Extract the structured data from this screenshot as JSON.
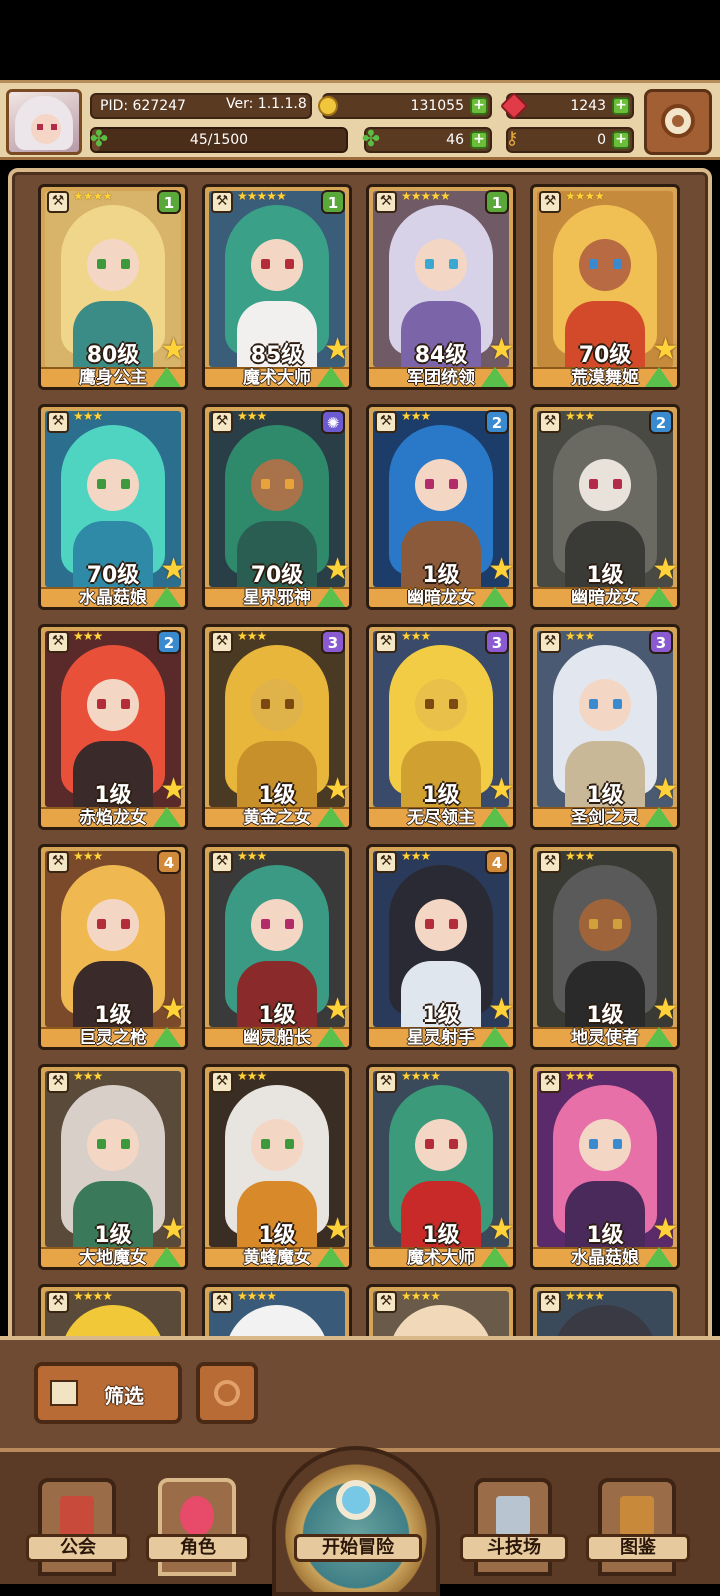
{
  "header": {
    "pid": "PID: 627247",
    "version": "Ver: 1.1.1.8",
    "gold": "131055",
    "gems": "1243",
    "clovers": "46",
    "keys": "0",
    "stamina": "45/1500",
    "stamina_fraction": 0.03
  },
  "cards": [
    {
      "name": "鹰身公主",
      "level": "80级",
      "badge": "1",
      "badge_color": "#5aa83a",
      "stars": "★★★★",
      "hair": "#f0d68a",
      "skin": "#f4d6c4",
      "eye": "#3c9a3c",
      "outfit": "#3b8c86",
      "bg": "#d7b46a"
    },
    {
      "name": "魔术大师",
      "level": "85级",
      "badge": "1",
      "badge_color": "#5aa83a",
      "stars": "★★★★★",
      "hair": "#3aa087",
      "skin": "#f4d6c4",
      "eye": "#b42b3a",
      "outfit": "#f2f0ee",
      "bg": "#3a5d7a"
    },
    {
      "name": "军团统领",
      "level": "84级",
      "badge": "1",
      "badge_color": "#5aa83a",
      "stars": "★★★★★",
      "hair": "#d7d2e8",
      "skin": "#f4d6c4",
      "eye": "#3aa8d0",
      "outfit": "#7b64a8",
      "bg": "#6f5a66"
    },
    {
      "name": "荒漠舞姬",
      "level": "70级",
      "badge": "",
      "badge_color": "",
      "stars": "★★★★",
      "hair": "#f0c054",
      "skin": "#b86a42",
      "eye": "#3a8ad0",
      "outfit": "#d24a2a",
      "bg": "#c68a3c"
    },
    {
      "name": "水晶菇娘",
      "level": "70级",
      "badge": "",
      "badge_color": "",
      "stars": "★★★",
      "hair": "#4fd4c2",
      "skin": "#f4d6c4",
      "eye": "#3c9a3c",
      "outfit": "#2f8aa8",
      "bg": "#2c6e8e"
    },
    {
      "name": "星界邪神",
      "level": "70级",
      "badge": "✺",
      "badge_color": "#6b5ad0",
      "stars": "★★★",
      "hair": "#2e8a6a",
      "skin": "#a8724a",
      "eye": "#e8a43a",
      "outfit": "#2a5e52",
      "bg": "#2a3e48"
    },
    {
      "name": "幽暗龙女",
      "level": "1级",
      "badge": "2",
      "badge_color": "#3a8ad0",
      "stars": "★★★",
      "hair": "#2a78c8",
      "skin": "#f4d6c4",
      "eye": "#b42b6a",
      "outfit": "#8a5a3a",
      "bg": "#1c3c6a"
    },
    {
      "name": "幽暗龙女",
      "level": "1级",
      "badge": "2",
      "badge_color": "#3a8ad0",
      "stars": "★★★",
      "hair": "#6a6a62",
      "skin": "#e8e2da",
      "eye": "#b42b4a",
      "outfit": "#3a3a36",
      "bg": "#4a4a44"
    },
    {
      "name": "赤焰龙女",
      "level": "1级",
      "badge": "2",
      "badge_color": "#3a8ad0",
      "stars": "★★★",
      "hair": "#e8503a",
      "skin": "#f4d6c4",
      "eye": "#b42b3a",
      "outfit": "#3a2a2a",
      "bg": "#5a2a2a"
    },
    {
      "name": "黄金之女",
      "level": "1级",
      "badge": "3",
      "badge_color": "#8a5ad0",
      "stars": "★★★",
      "hair": "#e8b63a",
      "skin": "#e0b24a",
      "eye": "#7a4a10",
      "outfit": "#c8902a",
      "bg": "#4a3a24"
    },
    {
      "name": "无尽领主",
      "level": "1级",
      "badge": "3",
      "badge_color": "#8a5ad0",
      "stars": "★★★",
      "hair": "#f2cc44",
      "skin": "#e8c04a",
      "eye": "#7a4a10",
      "outfit": "#d0a030",
      "bg": "#3a4a6a"
    },
    {
      "name": "圣剑之灵",
      "level": "1级",
      "badge": "3",
      "badge_color": "#8a5ad0",
      "stars": "★★★",
      "hair": "#e2e6ee",
      "skin": "#f4d6c4",
      "eye": "#3a8ad0",
      "outfit": "#c8b898",
      "bg": "#4a5a72"
    },
    {
      "name": "巨灵之枪",
      "level": "1级",
      "badge": "4",
      "badge_color": "#d08a3a",
      "stars": "★★★",
      "hair": "#f0b850",
      "skin": "#f4d6c4",
      "eye": "#b42b3a",
      "outfit": "#3a2a2a",
      "bg": "#7a4a2a"
    },
    {
      "name": "幽灵船长",
      "level": "1级",
      "badge": "",
      "badge_color": "",
      "stars": "★★★",
      "hair": "#3a9a84",
      "skin": "#f4d6c4",
      "eye": "#b42b6a",
      "outfit": "#8a2a2a",
      "bg": "#3a3a3a"
    },
    {
      "name": "星灵射手",
      "level": "1级",
      "badge": "4",
      "badge_color": "#d08a3a",
      "stars": "★★★",
      "hair": "#2a2a34",
      "skin": "#f4d6c4",
      "eye": "#b42b3a",
      "outfit": "#dfe6ee",
      "bg": "#2a3a5a"
    },
    {
      "name": "地灵使者",
      "level": "1级",
      "badge": "",
      "badge_color": "",
      "stars": "★★★",
      "hair": "#5a5a5a",
      "skin": "#a0643a",
      "eye": "#d0a03a",
      "outfit": "#2a2a2a",
      "bg": "#3a3a34"
    },
    {
      "name": "大地魔女",
      "level": "1级",
      "badge": "",
      "badge_color": "",
      "stars": "★★★",
      "hair": "#d8d0c8",
      "skin": "#f4d6c4",
      "eye": "#3c9a3c",
      "outfit": "#3a7a5a",
      "bg": "#5a4a3a"
    },
    {
      "name": "黄蜂魔女",
      "level": "1级",
      "badge": "",
      "badge_color": "",
      "stars": "★★★",
      "hair": "#e8e4e0",
      "skin": "#f4d6c4",
      "eye": "#3c9a3c",
      "outfit": "#d88a2a",
      "bg": "#3a2e24"
    },
    {
      "name": "魔术大师",
      "level": "1级",
      "badge": "",
      "badge_color": "",
      "stars": "★★★★",
      "hair": "#3a9a7a",
      "skin": "#f4d6c4",
      "eye": "#b42b3a",
      "outfit": "#c82a2a",
      "bg": "#3a4a5a"
    },
    {
      "name": "水晶菇娘",
      "level": "1级",
      "badge": "",
      "badge_color": "",
      "stars": "★★★",
      "hair": "#e870a8",
      "skin": "#f4d6c4",
      "eye": "#3a8ad0",
      "outfit": "#4a2a5a",
      "bg": "#5a2a6a"
    },
    {
      "name": "",
      "level": "",
      "badge": "",
      "badge_color": "",
      "stars": "★★★★",
      "hair": "#f0c838",
      "skin": "#f4d6c4",
      "eye": "#3a3a3a",
      "outfit": "#d0a030",
      "bg": "#5a4a3a"
    },
    {
      "name": "",
      "level": "",
      "badge": "",
      "badge_color": "",
      "stars": "★★★★",
      "hair": "#f2f2f2",
      "skin": "#f4d6c4",
      "eye": "#3a3a3a",
      "outfit": "#f2f2f2",
      "bg": "#3a5a7a"
    },
    {
      "name": "",
      "level": "",
      "badge": "",
      "badge_color": "",
      "stars": "★★★★",
      "hair": "#f0d8b8",
      "skin": "#f4d6c4",
      "eye": "#3a3a3a",
      "outfit": "#e8d0b0",
      "bg": "#6a5a4a"
    },
    {
      "name": "",
      "level": "",
      "badge": "",
      "badge_color": "",
      "stars": "★★★★",
      "hair": "#3a3a44",
      "skin": "#f4d6c4",
      "eye": "#3a3a3a",
      "outfit": "#2a2a34",
      "bg": "#3a4a5a"
    }
  ],
  "controls": {
    "filter_label": "筛选"
  },
  "nav": {
    "guild": "公会",
    "characters": "角色",
    "start": "开始冒险",
    "arena": "斗技场",
    "codex": "图鉴"
  },
  "icons": {
    "gold": "gold-coin-icon",
    "gem": "red-gem-icon",
    "clover": "clover-icon",
    "key": "key-icon",
    "settings": "gear-icon"
  }
}
